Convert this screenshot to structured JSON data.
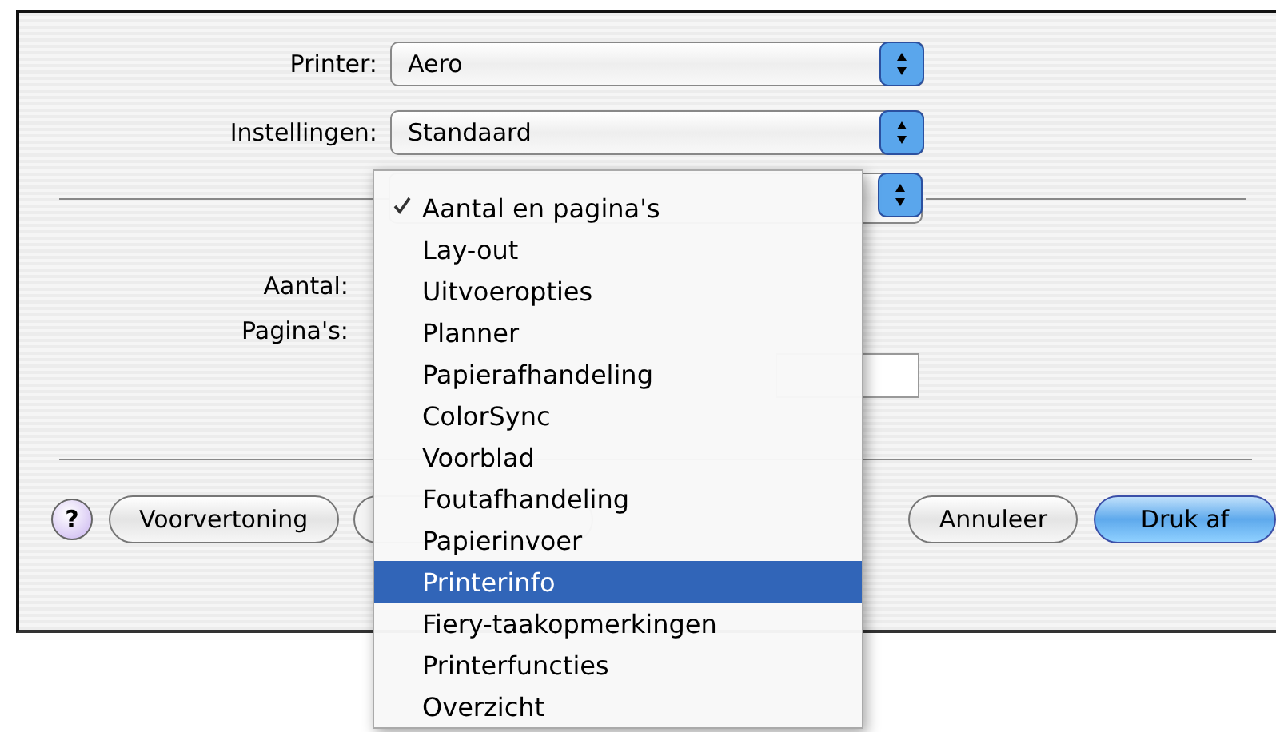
{
  "dialog": {
    "printer": {
      "label": "Printer:",
      "value": "Aero"
    },
    "settings": {
      "label": "Instellingen:",
      "value": "Standaard"
    },
    "copies_label": "Aantal:",
    "pages_label": "Pagina's:",
    "help": {
      "label": "?"
    },
    "buttons": [
      {
        "label": "Voorvertoning",
        "kind": "normal"
      },
      {
        "label": "Annuleer",
        "kind": "normal"
      },
      {
        "label": "Druk af",
        "kind": "default"
      }
    ]
  },
  "menu": {
    "items": [
      {
        "label": "Aantal en pagina's",
        "checked": true,
        "selected": false
      },
      {
        "label": "Lay-out",
        "checked": false,
        "selected": false
      },
      {
        "label": "Uitvoeropties",
        "checked": false,
        "selected": false
      },
      {
        "label": "Planner",
        "checked": false,
        "selected": false
      },
      {
        "label": "Papierafhandeling",
        "checked": false,
        "selected": false
      },
      {
        "label": "ColorSync",
        "checked": false,
        "selected": false
      },
      {
        "label": "Voorblad",
        "checked": false,
        "selected": false
      },
      {
        "label": "Foutafhandeling",
        "checked": false,
        "selected": false
      },
      {
        "label": "Papierinvoer",
        "checked": false,
        "selected": false
      },
      {
        "label": "Printerinfo",
        "checked": false,
        "selected": true
      },
      {
        "label": "Fiery-taakopmerkingen",
        "checked": false,
        "selected": false
      },
      {
        "label": "Printerfuncties",
        "checked": false,
        "selected": false
      },
      {
        "label": "Overzicht",
        "checked": false,
        "selected": false
      }
    ]
  }
}
